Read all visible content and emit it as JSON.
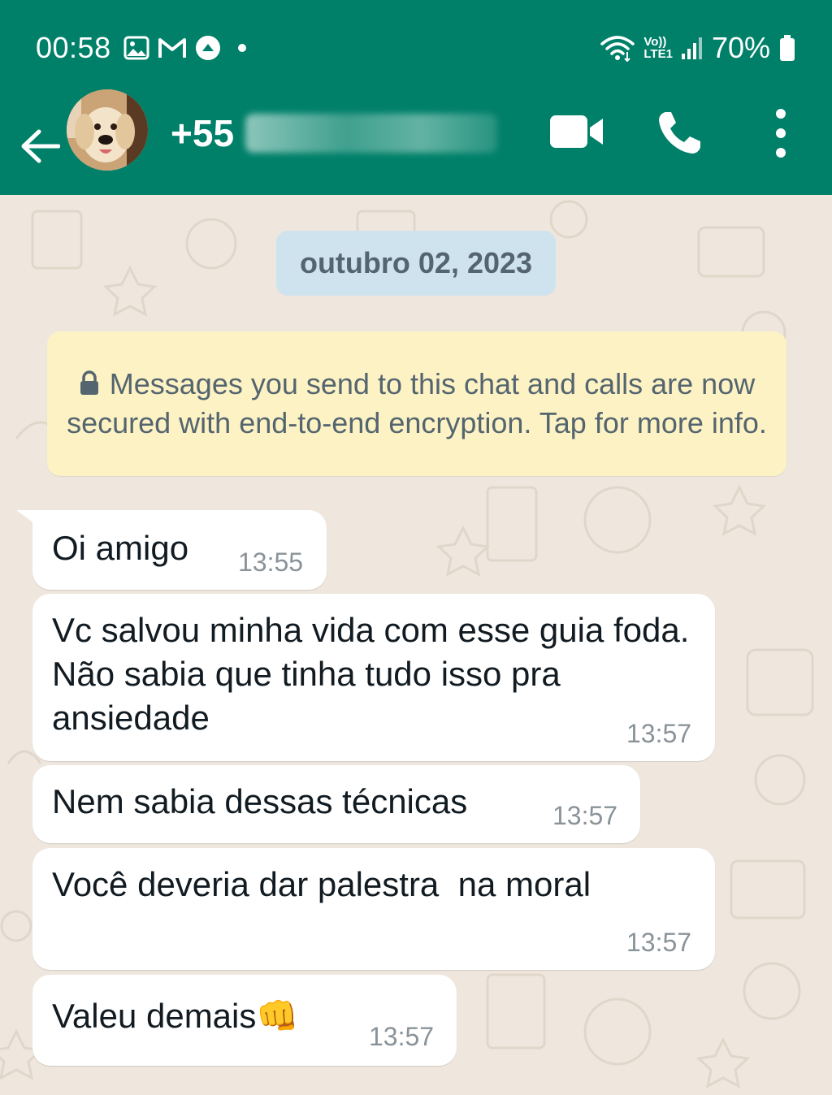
{
  "status_bar": {
    "time": "00:58",
    "network_label_top": "Vo))",
    "network_label_bottom": "LTE1",
    "battery": "70%"
  },
  "header": {
    "contact_prefix": "+55",
    "video_icon": "video-call-icon",
    "call_icon": "phone-icon",
    "menu_icon": "more-vert-icon"
  },
  "chat": {
    "date_chip": "outubro 02, 2023",
    "encryption_notice": "Messages you send to this chat and calls are now secured with end-to-end encryption. Tap for more info.",
    "messages": [
      {
        "text": "Oi amigo",
        "time": "13:55"
      },
      {
        "text": "Vc salvou minha vida com esse guia foda. Não sabia que tinha tudo isso pra ansiedade",
        "time": "13:57"
      },
      {
        "text": "Nem sabia dessas técnicas",
        "time": "13:57"
      },
      {
        "text": "Você deveria dar palestra  na moral",
        "time": "13:57"
      },
      {
        "text": "Valeu demais👊",
        "time": "13:57"
      }
    ]
  },
  "colors": {
    "header_green": "#008069",
    "wallpaper": "#efe7de",
    "date_chip": "#cfe3ee",
    "notice_yellow": "#fdf2c4",
    "bubble": "#ffffff"
  }
}
